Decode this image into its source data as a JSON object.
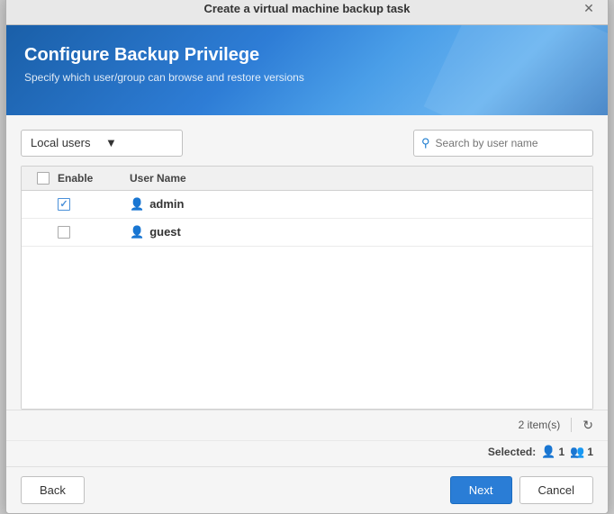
{
  "dialog": {
    "title": "Create a virtual machine backup task",
    "header": {
      "title": "Configure Backup Privilege",
      "subtitle": "Specify which user/group can browse and restore versions"
    }
  },
  "toolbar": {
    "dropdown_label": "Local users",
    "search_placeholder": "Search by user name"
  },
  "table": {
    "col_enable": "Enable",
    "col_username": "User Name",
    "rows": [
      {
        "id": 1,
        "checked": true,
        "username": "admin"
      },
      {
        "id": 2,
        "checked": false,
        "username": "guest"
      }
    ]
  },
  "footer": {
    "item_count": "2 item(s)",
    "selected_label": "Selected:",
    "selected_user_count": "1",
    "selected_group_count": "1"
  },
  "buttons": {
    "back": "Back",
    "next": "Next",
    "cancel": "Cancel"
  }
}
